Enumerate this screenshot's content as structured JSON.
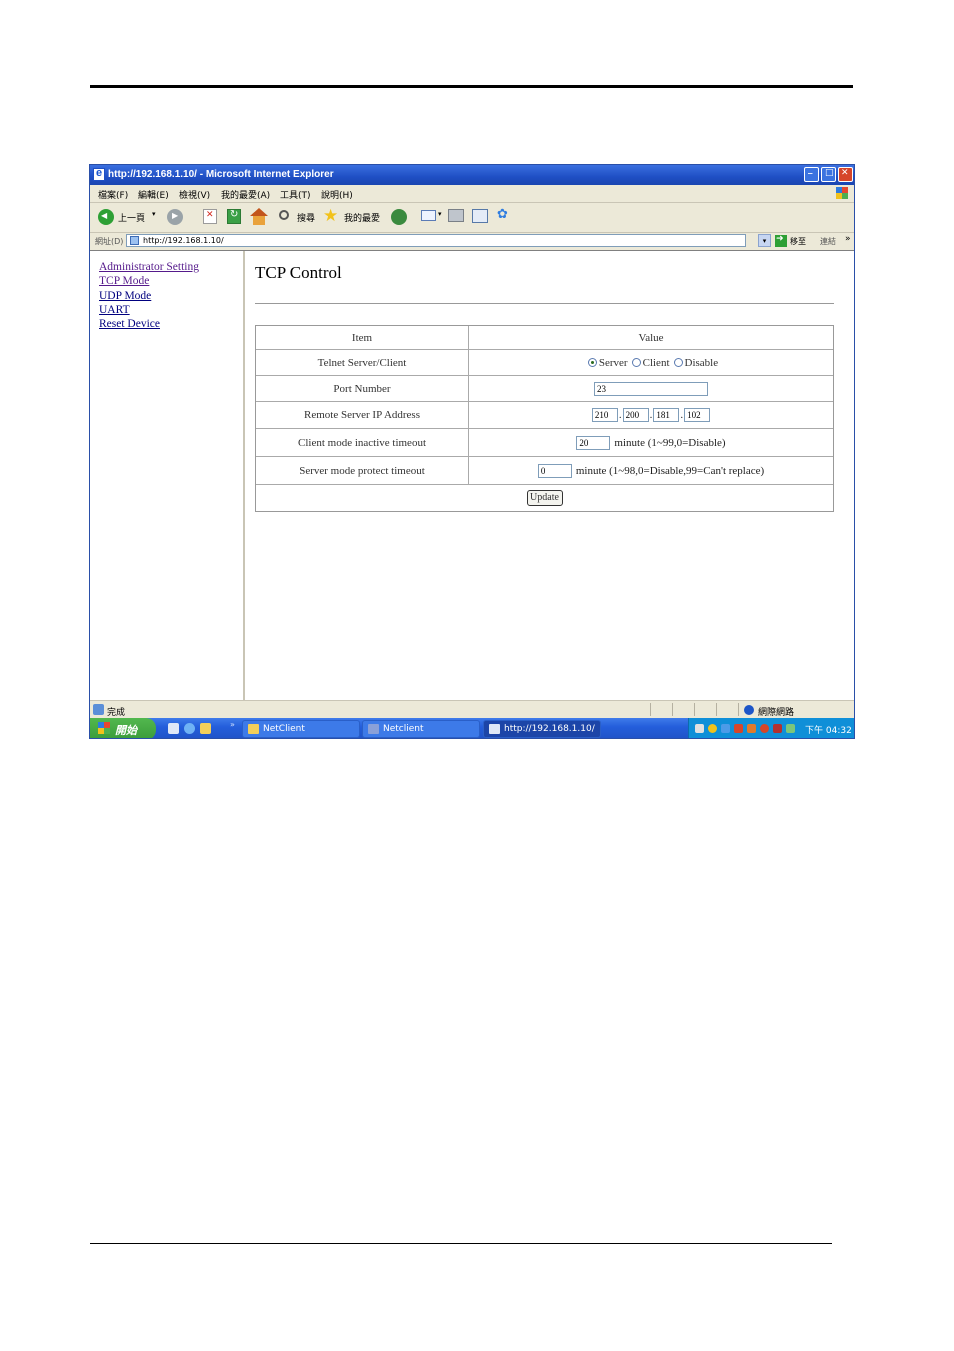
{
  "window": {
    "title": "http://192.168.1.10/ - Microsoft Internet Explorer"
  },
  "menubar": {
    "items": [
      "檔案(F)",
      "編輯(E)",
      "檢視(V)",
      "我的最愛(A)",
      "工具(T)",
      "說明(H)"
    ]
  },
  "toolbar": {
    "back_label": "上一頁",
    "search_label": "搜尋",
    "favorites_label": "我的最愛"
  },
  "addressbar": {
    "label": "網址(D)",
    "value": "http://192.168.1.10/",
    "go_label": "移至",
    "links_label": "連結",
    "links_chevron": "»"
  },
  "nav": {
    "links": [
      "Administrator Setting",
      "TCP Mode",
      "UDP Mode",
      "UART",
      "Reset Device"
    ]
  },
  "main": {
    "heading": "TCP Control",
    "table": {
      "header_item": "Item",
      "header_value": "Value",
      "telnet_label": "Telnet Server/Client",
      "telnet_options": [
        "Server",
        "Client",
        "Disable"
      ],
      "telnet_selected": "Server",
      "port_label": "Port Number",
      "port_value": "23",
      "remote_ip_label": "Remote Server IP Address",
      "remote_ip": [
        "210",
        "200",
        "181",
        "102"
      ],
      "ip_separator": ".",
      "client_timeout_label": "Client mode inactive timeout",
      "client_timeout_value": "20",
      "client_timeout_unit": "minute (1~99,0=Disable)",
      "server_timeout_label": "Server mode protect timeout",
      "server_timeout_value": "0",
      "server_timeout_unit": "minute (1~98,0=Disable,99=Can't replace)",
      "update_label": "Update"
    }
  },
  "statusbar": {
    "text": "完成",
    "zone": "網際網路"
  },
  "taskbar": {
    "start_label": "開始",
    "ql_chevron": "»",
    "buttons": [
      "NetClient",
      "Netclient",
      "http://192.168.1.10/ - ..."
    ],
    "clock": "下午 04:32"
  }
}
